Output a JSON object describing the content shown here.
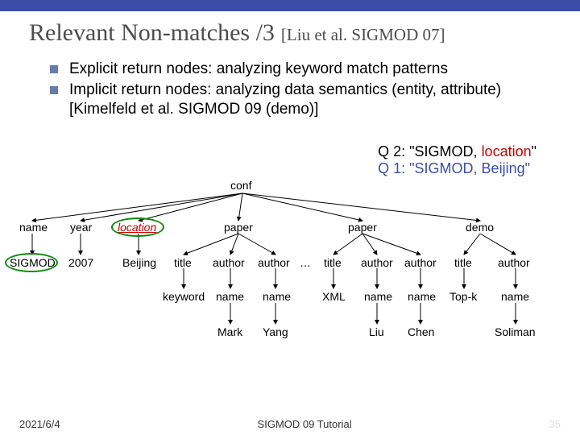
{
  "title": "Relevant Non-matches /3",
  "citation": "[Liu et al. SIGMOD 07]",
  "bullets": [
    "Explicit return nodes: analyzing keyword match patterns",
    "Implicit return nodes: analyzing data semantics (entity, attribute) [Kimelfeld et al. SIGMOD 09 (demo)]"
  ],
  "queries": {
    "q2": {
      "prefix": "Q 2: \"SIGMOD, ",
      "hl": "location",
      "suffix": "\""
    },
    "q1": "Q 1: \"SIGMOD, Beijing\""
  },
  "tree": {
    "conf": "conf",
    "name": "name",
    "year": "year",
    "location": "location",
    "paper": "paper",
    "demo": "demo",
    "sigmod": "SIGMOD",
    "y2007": "2007",
    "beijing": "Beijing",
    "title": "title",
    "author": "author",
    "dots": "…",
    "xml": "XML",
    "keyword": "keyword",
    "nameN": "name",
    "mark": "Mark",
    "yang": "Yang",
    "liu": "Liu",
    "chen": "Chen",
    "topk": "Top-k",
    "soliman": "Soliman"
  },
  "footer": {
    "date": "2021/6/4",
    "center": "SIGMOD 09 Tutorial",
    "page": "35"
  }
}
